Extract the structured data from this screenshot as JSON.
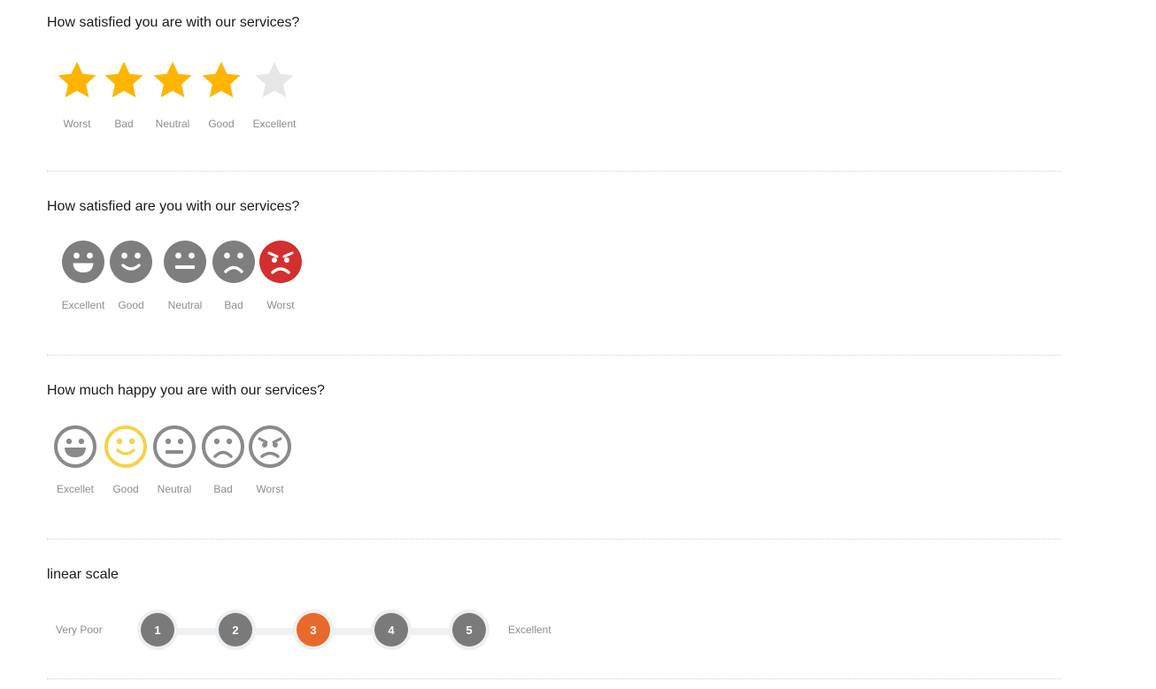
{
  "star_rating": {
    "question": "How satisfied you are with our services?",
    "selected": 4,
    "filled_color": "#FFB400",
    "empty_color": "#E6E6E6",
    "options": [
      {
        "label": "Worst",
        "icon": "star-icon"
      },
      {
        "label": "Bad",
        "icon": "star-icon"
      },
      {
        "label": "Neutral",
        "icon": "star-icon"
      },
      {
        "label": "Good",
        "icon": "star-icon"
      },
      {
        "label": "Excellent",
        "icon": "star-icon"
      }
    ]
  },
  "face_rating": {
    "question": "How satisfied are you with our services?",
    "selected_label": "Worst",
    "default_color": "#7E7E7E",
    "selected_color": "#D32F2F",
    "options": [
      {
        "label": "Excellent",
        "icon": "grinning-face-icon"
      },
      {
        "label": "Good",
        "icon": "smiling-face-icon"
      },
      {
        "label": "Neutral",
        "icon": "neutral-face-icon"
      },
      {
        "label": "Bad",
        "icon": "sad-face-icon"
      },
      {
        "label": "Worst",
        "icon": "angry-face-icon"
      }
    ]
  },
  "outline_face_rating": {
    "question": "How much happy you are with our services?",
    "selected_label": "Good",
    "default_color": "#8A8A8A",
    "selected_color": "#F2D44A",
    "options": [
      {
        "label": "Excellet",
        "icon": "grinning-face-outline-icon"
      },
      {
        "label": "Good",
        "icon": "smiling-face-outline-icon"
      },
      {
        "label": "Neutral",
        "icon": "neutral-face-outline-icon"
      },
      {
        "label": "Bad",
        "icon": "sad-face-outline-icon"
      },
      {
        "label": "Worst",
        "icon": "angry-face-outline-icon"
      }
    ]
  },
  "linear_scale": {
    "question": "linear scale",
    "min_label": "Very Poor",
    "max_label": "Excellent",
    "selected": 3,
    "default_color": "#7A7A7A",
    "selected_color": "#E8692C",
    "steps": [
      "1",
      "2",
      "3",
      "4",
      "5"
    ]
  }
}
